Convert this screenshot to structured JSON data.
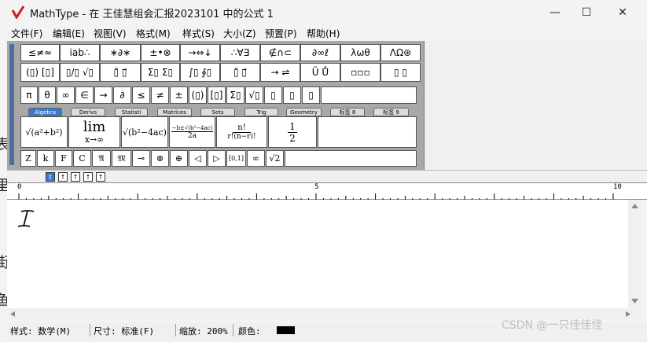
{
  "window": {
    "title": "MathType - 在 王佳慧组会汇报2023101 中的公式 1",
    "minimize_icon": "—",
    "maximize_icon": "☐",
    "close_icon": "✕"
  },
  "menu": [
    "文件(F)",
    "编辑(E)",
    "视图(V)",
    "格式(M)",
    "样式(S)",
    "大小(Z)",
    "预置(P)",
    "帮助(H)"
  ],
  "palette_row1": [
    "≤≠≈",
    "ⅰab∴",
    "∗∂∗",
    "±•⊗",
    "→⇔↓",
    "∴∀∃",
    "∉∩⊂",
    "∂∞ℓ",
    "λωθ",
    "ΛΩ⊛"
  ],
  "palette_row2": [
    "(▯) [▯]",
    "▯/▯ √▯",
    "▯̄ ▯⃗",
    "Σ▯ Σ▯",
    "∫▯ ∮▯",
    "▯̄ ▯⃗",
    "→ ⇌",
    "Ū Ů",
    "▫▫▫",
    "▯ ▯"
  ],
  "palette_row3": [
    "π",
    "θ",
    "∞",
    "∈",
    "→",
    "∂",
    "≤",
    "≠",
    "±",
    "(▯)",
    "[▯]",
    "Σ▯",
    "√▯",
    "▯",
    "▯",
    "▯"
  ],
  "tabs": [
    "Algebra",
    "Derivs",
    "Statisti",
    "Matrices",
    "Sets",
    "Trig",
    "Geometry",
    "标签 8",
    "标签 9"
  ],
  "templates": [
    "√(a²+b²)",
    "lim x→∞",
    "√(b²−4ac)",
    "(−b±√(b²−4ac))/2a",
    "n!/(r!(n−r)!)",
    "1/2"
  ],
  "templates_lim": {
    "top": "lim",
    "bottom": "x→∞"
  },
  "templates_frac1": {
    "num": "−b±√(b²−4ac)",
    "den": "2a"
  },
  "templates_frac2": {
    "num": "n!",
    "den": "r!(n−r)!"
  },
  "templates_half": {
    "num": "1",
    "den": "2"
  },
  "symbols": [
    "Z",
    "k",
    "F",
    "C",
    "𝔄",
    "𝔐",
    "⊸",
    "⊗",
    "⊕",
    "◁",
    "▷",
    "[0,1]",
    "∞",
    "√2"
  ],
  "nudge": [
    "t",
    "↑",
    "↑",
    "↑",
    "↑"
  ],
  "ruler": {
    "marks": [
      "0",
      "5",
      "10"
    ]
  },
  "status": {
    "style_label": "样式: 数学(M)",
    "size_label": "尺寸: 标准(F)",
    "zoom_label": "缩放: 200%",
    "color_label": "颜色:",
    "color": "#000000"
  },
  "watermark": "CSDN @一只佳佳怪",
  "left_doc_chars": [
    "表",
    "里",
    "街",
    "鱼"
  ]
}
